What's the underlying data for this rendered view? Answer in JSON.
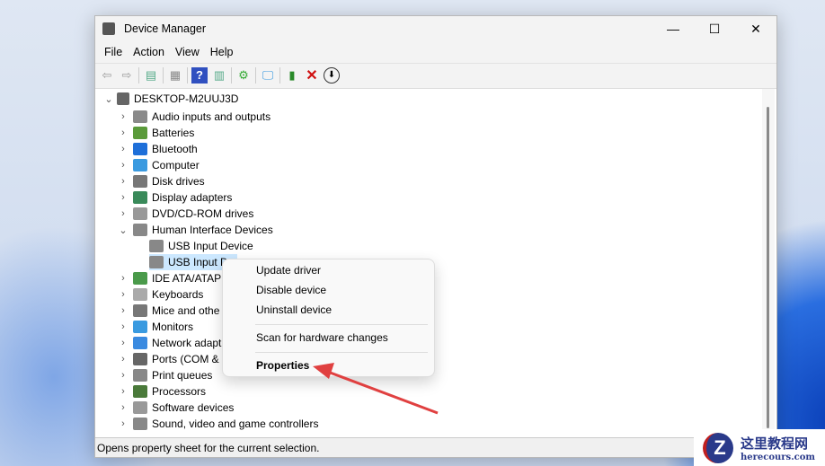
{
  "window": {
    "title": "Device Manager",
    "minimize": "—",
    "maximize": "☐",
    "close": "✕"
  },
  "menu": [
    "File",
    "Action",
    "View",
    "Help"
  ],
  "toolbar": [
    "back",
    "forward",
    "show-hide-console-tree",
    "properties",
    "help",
    "action-pane",
    "update-driver",
    "scan-hardware",
    "enable-device",
    "uninstall",
    "disable"
  ],
  "tree": {
    "root": "DESKTOP-M2UUJ3D",
    "categories": [
      {
        "label": "Audio inputs and outputs",
        "color": "#8a8a8a"
      },
      {
        "label": "Batteries",
        "color": "#5a9a3a"
      },
      {
        "label": "Bluetooth",
        "color": "#1e6fd9"
      },
      {
        "label": "Computer",
        "color": "#3a9ae0"
      },
      {
        "label": "Disk drives",
        "color": "#777"
      },
      {
        "label": "Display adapters",
        "color": "#3a8a5a"
      },
      {
        "label": "DVD/CD-ROM drives",
        "color": "#999"
      },
      {
        "label": "Human Interface Devices",
        "color": "#888",
        "expanded": true
      },
      {
        "label": "IDE ATA/ATAPI",
        "color": "#4a9a4a"
      },
      {
        "label": "Keyboards",
        "color": "#aaa"
      },
      {
        "label": "Mice and othe",
        "color": "#777"
      },
      {
        "label": "Monitors",
        "color": "#3a9ae0"
      },
      {
        "label": "Network adapt",
        "color": "#3a8ae0"
      },
      {
        "label": "Ports (COM &",
        "color": "#666"
      },
      {
        "label": "Print queues",
        "color": "#888"
      },
      {
        "label": "Processors",
        "color": "#4a7a3a"
      },
      {
        "label": "Software devices",
        "color": "#999"
      },
      {
        "label": "Sound, video and game controllers",
        "color": "#888"
      }
    ],
    "hid_children": [
      "USB Input Device",
      "USB Input De"
    ]
  },
  "context_menu": {
    "items": [
      "Update driver",
      "Disable device",
      "Uninstall device",
      "Scan for hardware changes",
      "Properties"
    ]
  },
  "status": "Opens property sheet for the current selection.",
  "watermark": {
    "title": "这里教程网",
    "url": "herecours.com"
  },
  "accent": "#e04040"
}
